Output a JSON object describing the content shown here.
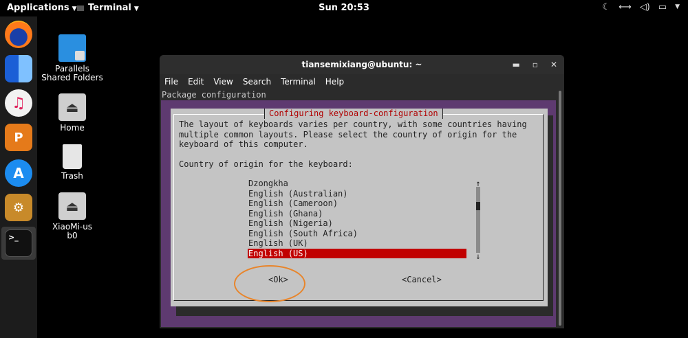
{
  "topbar": {
    "applications": "Applications",
    "terminal_app": "Terminal",
    "clock": "Sun 20:53"
  },
  "desktop": {
    "icons": [
      {
        "label": "Parallels Shared Folders"
      },
      {
        "label": "Home"
      },
      {
        "label": "Trash"
      },
      {
        "label": "XiaoMi-usb0"
      }
    ]
  },
  "window": {
    "title": "tiansemixiang@ubuntu: ~",
    "menu": [
      "File",
      "Edit",
      "View",
      "Search",
      "Terminal",
      "Help"
    ],
    "header_line": "Package configuration"
  },
  "dialog": {
    "title": "Configuring keyboard-configuration",
    "description": "The layout of keyboards varies per country, with some countries having\nmultiple common layouts. Please select the country of origin for the\nkeyboard of this computer.\n\nCountry of origin for the keyboard:",
    "options": [
      "Dzongkha",
      "English (Australian)",
      "English (Cameroon)",
      "English (Ghana)",
      "English (Nigeria)",
      "English (South Africa)",
      "English (UK)",
      "English (US)"
    ],
    "selected": "English (US)",
    "ok_label": "<Ok>",
    "cancel_label": "<Cancel>",
    "scroll_up": "↑",
    "scroll_down": "↓"
  },
  "colors": {
    "terminal_bg": "#5e3a70",
    "dialog_bg": "#c4c4c4",
    "selection": "#c10000",
    "title_text": "#b00000",
    "highlight_circle": "#e8852b"
  }
}
